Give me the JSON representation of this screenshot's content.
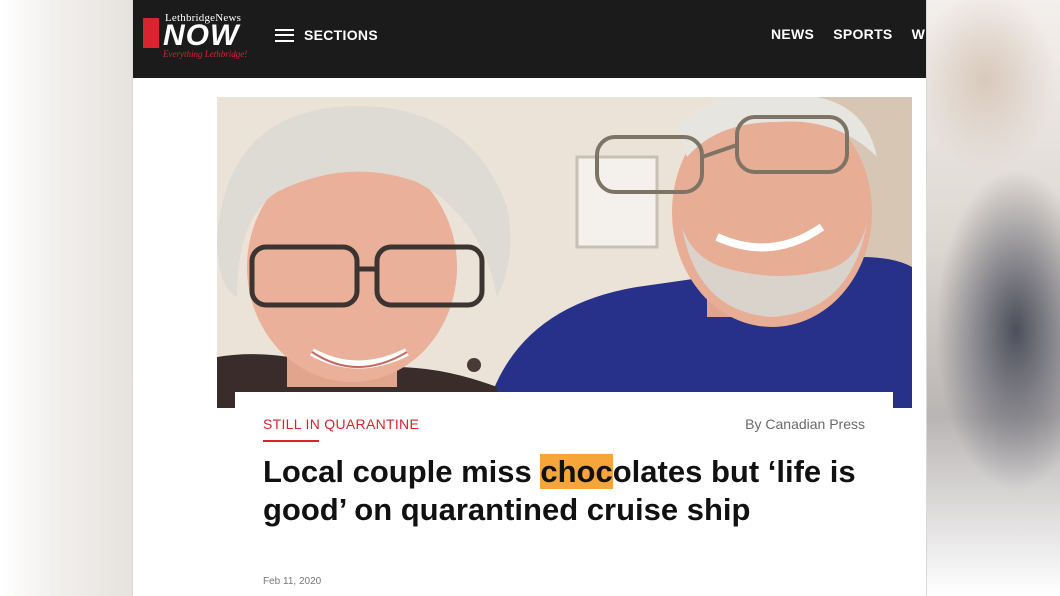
{
  "header": {
    "logo": {
      "small_text": "LethbridgeNews",
      "big_text": "NOW",
      "tagline": "Everything Lethbridge!"
    },
    "sections_label": "SECTIONS",
    "nav_items": [
      {
        "label": "NEWS"
      },
      {
        "label": "SPORTS"
      },
      {
        "label": "W"
      }
    ]
  },
  "article": {
    "category": "STILL IN QUARANTINE",
    "byline": "By Canadian Press",
    "headline_before": "Local couple miss ",
    "headline_highlight": "choc",
    "headline_after": "olates but ‘life is good’ on quarantined cruise ship",
    "date": "Feb 11, 2020"
  },
  "colors": {
    "brand_red": "#d7242f",
    "header_bg": "#1b1b1b",
    "highlight": "#f5a53a"
  },
  "icons": [
    "hamburger-menu-icon"
  ]
}
